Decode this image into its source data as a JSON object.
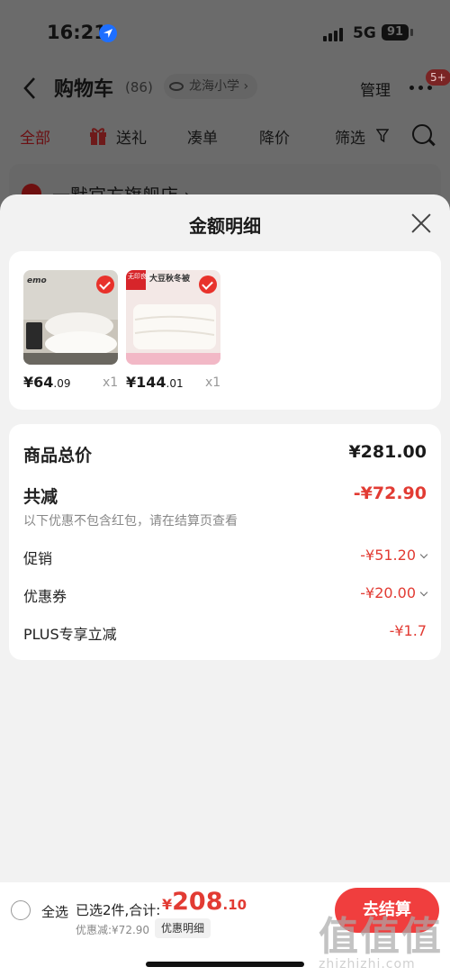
{
  "status_bar": {
    "time": "16:21",
    "network": "5G",
    "battery": "91"
  },
  "nav": {
    "title": "购物车",
    "count": "(86)",
    "location": "龙海小学",
    "manage": "管理",
    "badge": "5+"
  },
  "tabs": [
    {
      "label": "全部",
      "active": true
    },
    {
      "label": "送礼"
    },
    {
      "label": "凑单"
    },
    {
      "label": "降价"
    },
    {
      "label": "筛选"
    }
  ],
  "store_peek": {
    "name": "一默官方旗舰店 ›"
  },
  "sheet": {
    "title": "金额明细",
    "goods": [
      {
        "price_int": "¥64",
        "price_dec": ".09",
        "qty": "x1",
        "brand": "emo",
        "icon": "pillow-product-thumbnail"
      },
      {
        "price_int": "¥144",
        "price_dec": ".01",
        "qty": "x1",
        "brand": "无印良品",
        "headline": "大豆秋冬被",
        "icon": "quilt-product-thumbnail"
      }
    ],
    "summary": {
      "total_label": "商品总价",
      "total_value": "¥281.00",
      "reduce_label": "共减",
      "reduce_value": "-¥72.90",
      "hint": "以下优惠不包含红包，请在结算页查看",
      "rows": [
        {
          "label": "促销",
          "value": "-¥51.20"
        },
        {
          "label": "优惠券",
          "value": "-¥20.00"
        },
        {
          "label": "PLUS专享立减",
          "value": "-¥1.7"
        }
      ]
    }
  },
  "bottom": {
    "select_all": "全选",
    "selected": "已选2件,合计:",
    "currency": "¥",
    "total_int": "208",
    "total_dec": ".10",
    "discount": "优惠减:¥72.90",
    "detail_button": "优惠明细",
    "checkout": "去结算"
  },
  "watermark": {
    "glyphs": "值值值",
    "url": "zhizhizhi.com"
  },
  "colors": {
    "accent": "#e23b33",
    "checkout": "#f03e3e",
    "dim": "#6b6b6b"
  }
}
